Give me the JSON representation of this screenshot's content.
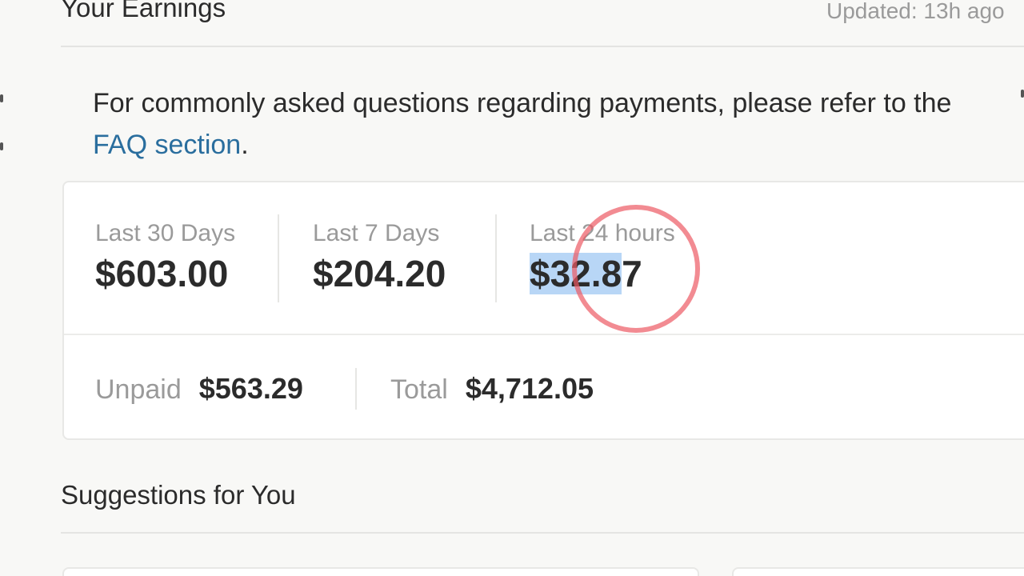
{
  "header": {
    "title": "Your Earnings",
    "updated": "Updated: 13h ago"
  },
  "notice": {
    "text_before": "For commonly asked questions regarding payments, please refer to the ",
    "link_text": "FAQ section",
    "text_after": "."
  },
  "earnings": {
    "stats": [
      {
        "label": "Last 30 Days",
        "value": "$603.00"
      },
      {
        "label": "Last 7 Days",
        "value": "$204.20"
      },
      {
        "label": "Last 24 hours",
        "value_highlighted": "$32.8",
        "value_rest": "7"
      }
    ],
    "unpaid_label": "Unpaid",
    "unpaid_value": "$563.29",
    "total_label": "Total",
    "total_value": "$4,712.05"
  },
  "suggestions": {
    "title": "Suggestions for You"
  },
  "colors": {
    "link": "#2a6e9e",
    "selection": "#b8d6f6",
    "annotation_circle": "#ec5a64"
  }
}
